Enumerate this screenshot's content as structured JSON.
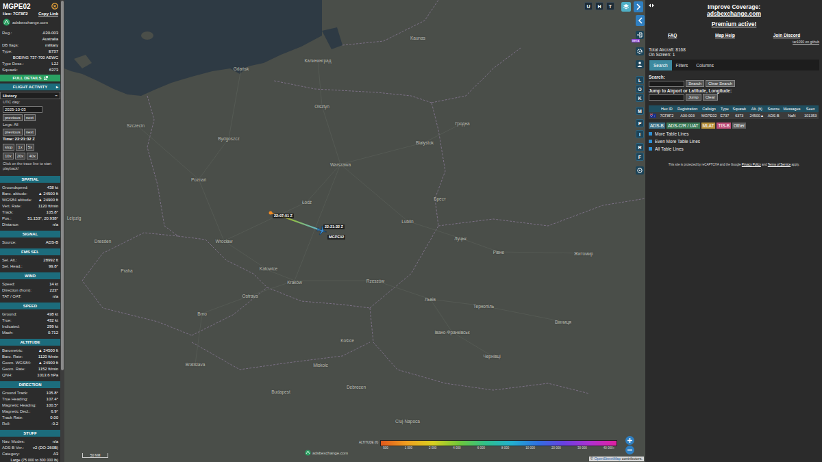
{
  "sidebar": {
    "title": "MGPE02",
    "hex_label": "Hex:",
    "hex": "7CF8F2",
    "copy_link": "Copy Link",
    "logo": "adsbexchange.com",
    "info": [
      {
        "label": "Reg.:",
        "value": "A30-003"
      },
      {
        "value": "Australia"
      },
      {
        "label": "DB flags:",
        "value": "military"
      },
      {
        "label": "Type:",
        "value": "E737"
      },
      {
        "value": "BOEING 737-700 AEWC"
      },
      {
        "label": "Type Desc.:",
        "value": "L2J"
      },
      {
        "label": "Squawk:",
        "value": "6373"
      }
    ],
    "full_details": "FULL DETAILS",
    "flight_activity": {
      "label": "FLIGHT ACTIVITY",
      "icon": "▸"
    },
    "history": {
      "label": "History",
      "icon": "−",
      "expanded": true
    },
    "utc_day_label": "UTC day:",
    "utc_day": "2025-10-03",
    "day_nav": [
      "previous",
      "next"
    ],
    "legs_label": "Legs: All",
    "legs_nav": [
      "previous",
      "next"
    ],
    "time": "Time: 22:21:32 Z",
    "playback": [
      [
        "stop",
        "1x",
        "5x"
      ],
      [
        "10x",
        "20x",
        "40x"
      ]
    ],
    "hint": "Click on the trace line to start playback!",
    "sections": [
      {
        "title": "SPATIAL",
        "rows": [
          {
            "label": "Groundspeed:",
            "value": "438 kt"
          },
          {
            "label": "Baro. altitude:",
            "value": "▲ 24500 ft"
          },
          {
            "label": "WGS84 altitude:",
            "value": "▲ 24900 ft"
          },
          {
            "label": "Vert. Rate:",
            "value": "1120 ft/min"
          },
          {
            "label": "Track:",
            "value": "105.8°"
          },
          {
            "label": "Pos.:",
            "value": "51.153°, 20.938°"
          },
          {
            "label": "Distance:",
            "value": "n/a"
          }
        ]
      },
      {
        "title": "SIGNAL",
        "rows": [
          {
            "label": "Source:",
            "value": "ADS-B"
          }
        ]
      },
      {
        "title": "FMS SEL",
        "rows": [
          {
            "label": "Sel. Alt.:",
            "value": "28992 ft"
          },
          {
            "label": "Sel. Head.:",
            "value": "99.8°"
          }
        ]
      },
      {
        "title": "WIND",
        "rows": [
          {
            "label": "Speed:",
            "value": "14 kt"
          },
          {
            "label": "Direction (from):",
            "value": "223°"
          },
          {
            "label": "TAT / OAT:",
            "value": "n/a"
          }
        ]
      },
      {
        "title": "SPEED",
        "rows": [
          {
            "label": "Ground:",
            "value": "438 kt"
          },
          {
            "label": "True:",
            "value": "432 kt"
          },
          {
            "label": "Indicated:",
            "value": "299 kt"
          },
          {
            "label": "Mach:",
            "value": "0.712"
          }
        ]
      },
      {
        "title": "ALTITUDE",
        "rows": [
          {
            "label": "Barometric:",
            "value": "▲ 24500 ft"
          },
          {
            "label": "Baro. Rate:",
            "value": "1120 ft/min"
          },
          {
            "label": "Geom. WGS84:",
            "value": "▲ 24900 ft"
          },
          {
            "label": "Geom. Rate:",
            "value": "1152 ft/min"
          },
          {
            "label": "QNH:",
            "value": "1013.6 hPa"
          }
        ]
      },
      {
        "title": "DIRECTION",
        "rows": [
          {
            "label": "Ground Track:",
            "value": "105.8°"
          },
          {
            "label": "True Heading:",
            "value": "107.4°"
          },
          {
            "label": "Magnetic Heading:",
            "value": "100.5°"
          },
          {
            "label": "Magnetic Decl.:",
            "value": "6.9°"
          },
          {
            "label": "Track Rate:",
            "value": "0.00"
          },
          {
            "label": "Roll:",
            "value": "-0.2"
          }
        ]
      },
      {
        "title": "STUFF",
        "rows": [
          {
            "label": "Nav. Modes:",
            "value": "n/a"
          },
          {
            "label": "ADS-B Ver.:",
            "value": "v2 (DO-260B)"
          },
          {
            "label": "Category:",
            "value": "A3"
          },
          {
            "value": "Large (75 000 to 300 000 lb)"
          }
        ]
      }
    ]
  },
  "map": {
    "labels": [
      "Калининград",
      "Gdańsk",
      "Olsztyn",
      "Szczecin",
      "Bydgoszcz",
      "Białystok",
      "Warszawa",
      "Poznań",
      "Łódź",
      "Lublin",
      "Wrocław",
      "Dresden",
      "Leipzig",
      "Praha",
      "Katowice",
      "Kraków",
      "Rzeszów",
      "Ostrava",
      "Brno",
      "Košice",
      "Bratislava",
      "Miskolc",
      "Debrecen",
      "Budapest",
      "Cluj-Napoca",
      "Брест",
      "Гродна",
      "Kaunas",
      "Луцьк",
      "Рівне",
      "Львів",
      "Тернопіль",
      "Івано-Франківськ",
      "Житомир",
      "Вінниця",
      "Чернівці"
    ],
    "trail": {
      "start_time": "22:07:01 Z",
      "end_time": "22:21:32 Z",
      "callsign": "MGPE02"
    },
    "controls": {
      "top": [
        "U",
        "H",
        "T"
      ],
      "column": [
        "L",
        "O",
        "K",
        "M",
        "P",
        "I",
        "R",
        "F"
      ],
      "beta": "BETA"
    },
    "scale": "50 NM",
    "logo": "adsbexchange.com",
    "attribution": {
      "prefix": "© ",
      "link": "OpenStreetMap",
      "suffix": " contributors."
    },
    "altitude_legend": {
      "title": "ALTITUDE (ft)",
      "ticks": [
        "500",
        "1 000",
        "2 000",
        "4 000",
        "6 000",
        "8 000",
        "10 000",
        "20 000",
        "30 000",
        "40 000+"
      ]
    }
  },
  "panel": {
    "coverage_title": "Improve Coverage:",
    "coverage_link": "adsbexchange.com",
    "premium": "Premium active!",
    "links": [
      "FAQ",
      "Map Help",
      "Join Discord"
    ],
    "github": "tar1090 on github",
    "total": "Total Aircraft: 8168",
    "on_screen": "On Screen: 1",
    "tabs": [
      {
        "label": "Search",
        "selected": true
      },
      {
        "label": "Filters",
        "selected": false
      },
      {
        "label": "Columns",
        "selected": false
      }
    ],
    "search_label": "Search:",
    "search_buttons": [
      "Search",
      "Clear Search"
    ],
    "jump_label": "Jump to Airport or Latitude, Longitude:",
    "jump_buttons": [
      "Jump",
      "Clear"
    ],
    "table": {
      "columns": [
        "Hex ID",
        "Registration",
        "Callsign",
        "Type",
        "Squawk",
        "Alt. (ft)",
        "Source",
        "Messages",
        "Seen"
      ],
      "rows": [
        {
          "cells": [
            "7CF8F2",
            "A30-003",
            "MGPE02",
            "E737",
            "6373",
            "24500▲",
            "ADS-B",
            "NaN",
            "101353"
          ],
          "selected": true
        }
      ]
    },
    "legend": [
      {
        "label": "ADS-B",
        "color": "#3a6f86"
      },
      {
        "label": "ADS-C/R / UAT",
        "color": "#3b7a57"
      },
      {
        "label": "MLAT",
        "color": "#b8913c"
      },
      {
        "label": "TIS-B",
        "color": "#c0507a"
      },
      {
        "label": "Other",
        "color": "#5f5f5f"
      }
    ],
    "options": [
      {
        "label": "More Table Lines",
        "checked": false
      },
      {
        "label": "Even More Table Lines",
        "checked": false
      },
      {
        "label": "All Table Lines",
        "checked": false
      }
    ],
    "recaptcha": [
      "This site is protected by reCAPTCHA and the Google ",
      "Privacy Policy",
      " and ",
      "Terms of Service",
      " apply."
    ]
  }
}
